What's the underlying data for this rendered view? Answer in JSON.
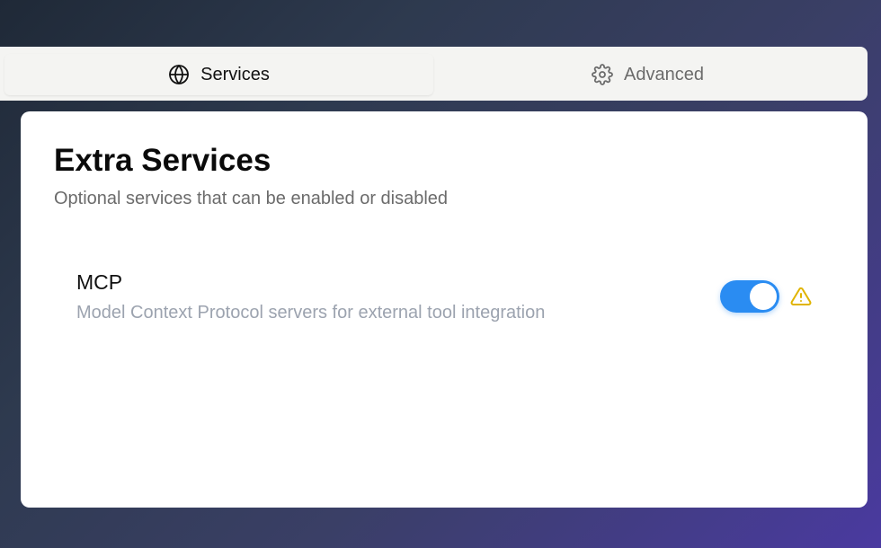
{
  "tabs": [
    {
      "label": "Services",
      "icon": "globe-icon",
      "active": true
    },
    {
      "label": "Advanced",
      "icon": "gear-icon",
      "active": false
    }
  ],
  "section": {
    "title": "Extra Services",
    "subtitle": "Optional services that can be enabled or disabled"
  },
  "services": [
    {
      "name": "MCP",
      "description": "Model Context Protocol servers for external tool integration",
      "enabled": true,
      "status_icon": "warning-icon"
    }
  ],
  "colors": {
    "toggle_on": "#2a8cf2",
    "warning": "#e0b400",
    "subtitle": "#6b6b6b",
    "description": "#9ca3af"
  }
}
